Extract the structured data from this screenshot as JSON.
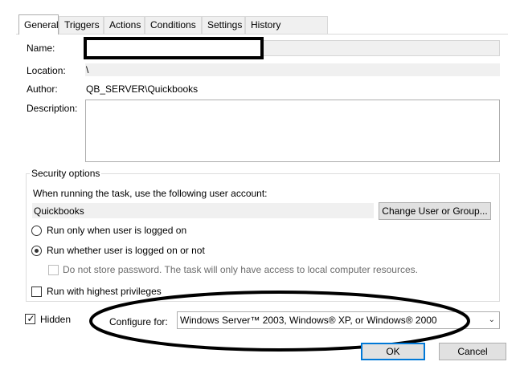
{
  "tabs": [
    "General",
    "Triggers",
    "Actions",
    "Conditions",
    "Settings",
    "History (disabled)"
  ],
  "general": {
    "name_label": "Name:",
    "name_value": "",
    "location_label": "Location:",
    "location_value": "\\",
    "author_label": "Author:",
    "author_value": "QB_SERVER\\Quickbooks",
    "description_label": "Description:",
    "description_value": ""
  },
  "security": {
    "group_label": "Security options",
    "account_prompt": "When running the task, use the following user account:",
    "account_value": "Quickbooks",
    "change_user_button": "Change User or Group...",
    "run_only_logged_on": "Run only when user is logged on",
    "run_whether_logged_on": "Run whether user is logged on or not",
    "selected_option": "run_whether_logged_on",
    "no_store_password": "Do not store password.  The task will only have access to local computer resources.",
    "no_store_password_checked": false,
    "highest_privileges": "Run with highest privileges",
    "highest_privileges_checked": false
  },
  "footer": {
    "hidden_label": "Hidden",
    "hidden_checked": true,
    "configure_label": "Configure for:",
    "configure_value": "Windows Server™ 2003, Windows® XP, or Windows® 2000",
    "ok_button": "OK",
    "cancel_button": "Cancel"
  },
  "colors": {
    "accent": "#0078d7",
    "annotation": "#000000"
  }
}
